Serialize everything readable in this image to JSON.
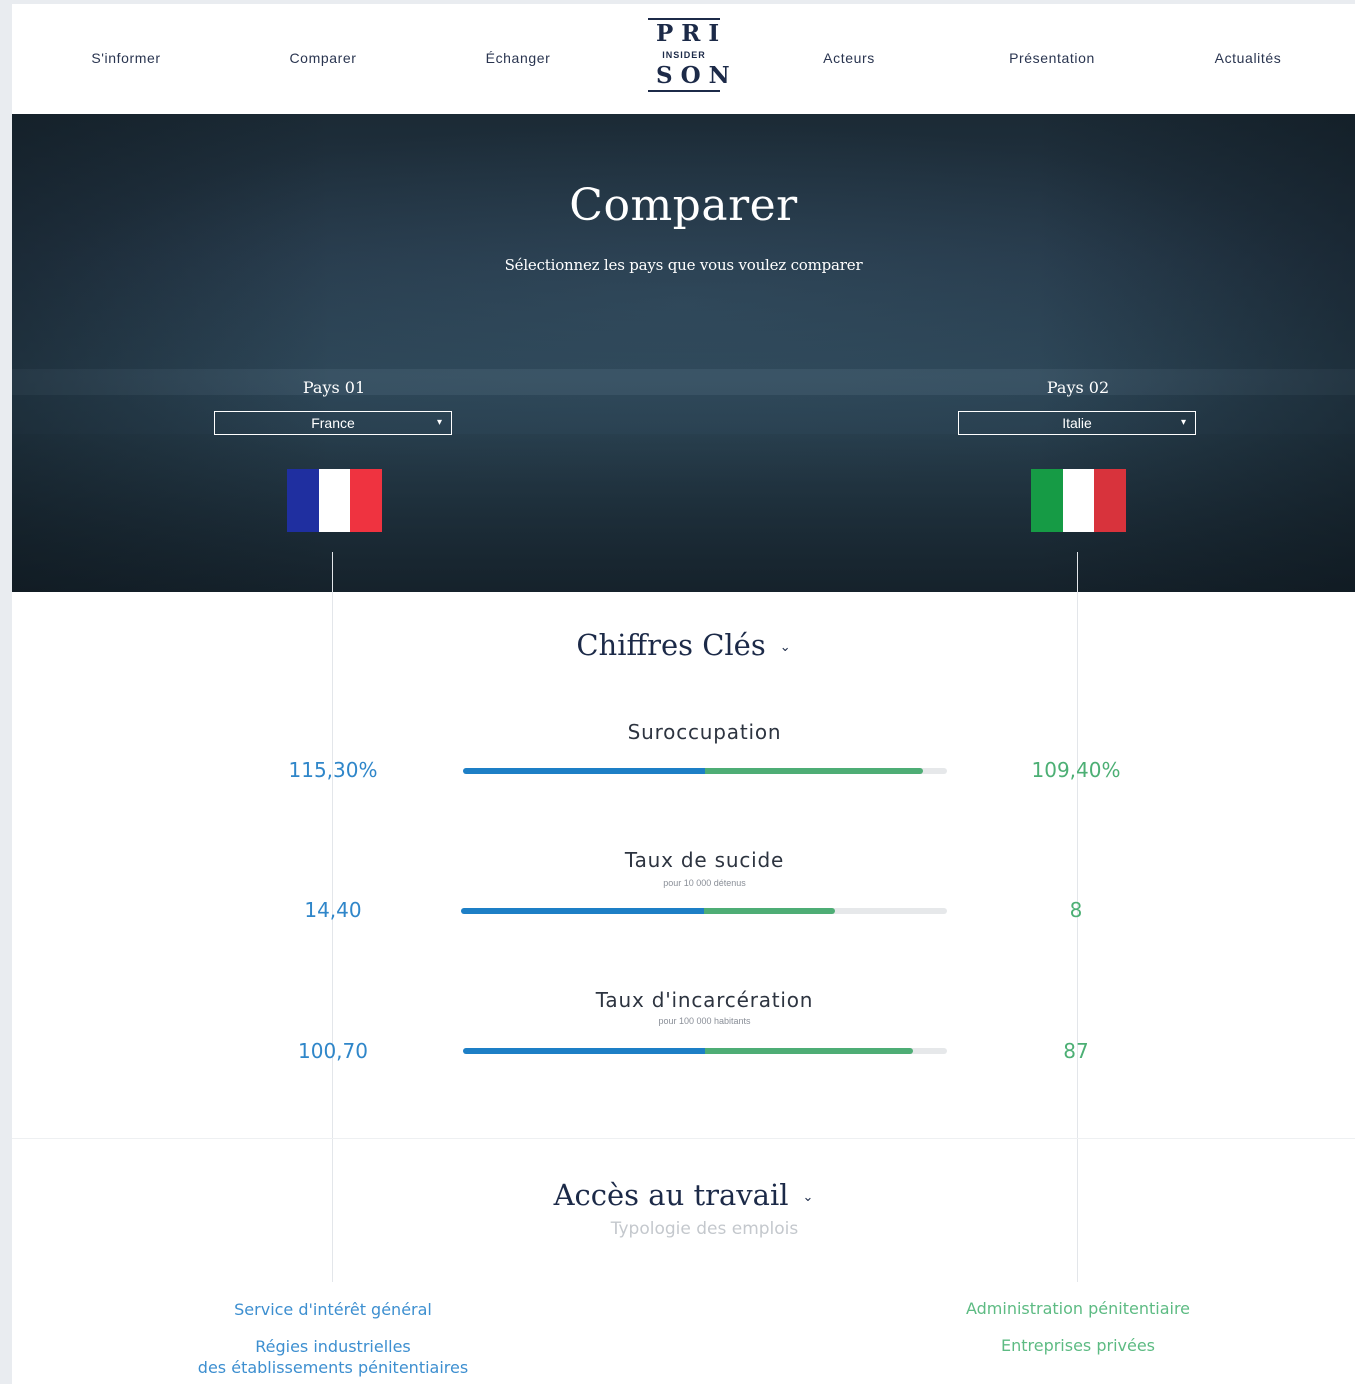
{
  "nav": {
    "items": [
      "S'informer",
      "Comparer",
      "Échanger",
      "Acteurs",
      "Présentation",
      "Actualités"
    ],
    "logo": {
      "top": "PRI",
      "middle": "INSIDER",
      "bottom": "SON"
    }
  },
  "hero": {
    "title": "Comparer",
    "subtitle": "Sélectionnez les pays que vous voulez comparer",
    "country1": {
      "label": "Pays 01",
      "selected": "France",
      "flag_colors": [
        "#1f2fa0",
        "#ffffff",
        "#ef3340"
      ]
    },
    "country2": {
      "label": "Pays 02",
      "selected": "Italie",
      "flag_colors": [
        "#169b45",
        "#ffffff",
        "#d8333c"
      ]
    }
  },
  "key_figures": {
    "title": "Chiffres Clés",
    "metrics": [
      {
        "label": "Suroccupation",
        "sub": "",
        "left_value": "115,30%",
        "right_value": "109,40%",
        "left_fill": 0.5,
        "right_fill": 0.95
      },
      {
        "label": "Taux de sucide",
        "sub": "pour 10 000 détenus",
        "left_value": "14,40",
        "right_value": "8",
        "left_fill": 0.5,
        "right_fill": 0.77
      },
      {
        "label": "Taux d'incarcération",
        "sub": "pour 100 000 habitants",
        "left_value": "100,70",
        "right_value": "87",
        "left_fill": 0.5,
        "right_fill": 0.93
      }
    ]
  },
  "work": {
    "title": "Accès au travail",
    "subtitle": "Typologie des emplois",
    "left_items": [
      "Service d'intérêt général",
      "Régies industrielles\ndes établissements pénitentiaires"
    ],
    "right_items": [
      "Administration pénitentiaire",
      "Entreprises privées"
    ]
  },
  "colors": {
    "accent_left": "#1d7fc6",
    "accent_right": "#4ead75",
    "navy": "#1c2a48"
  }
}
